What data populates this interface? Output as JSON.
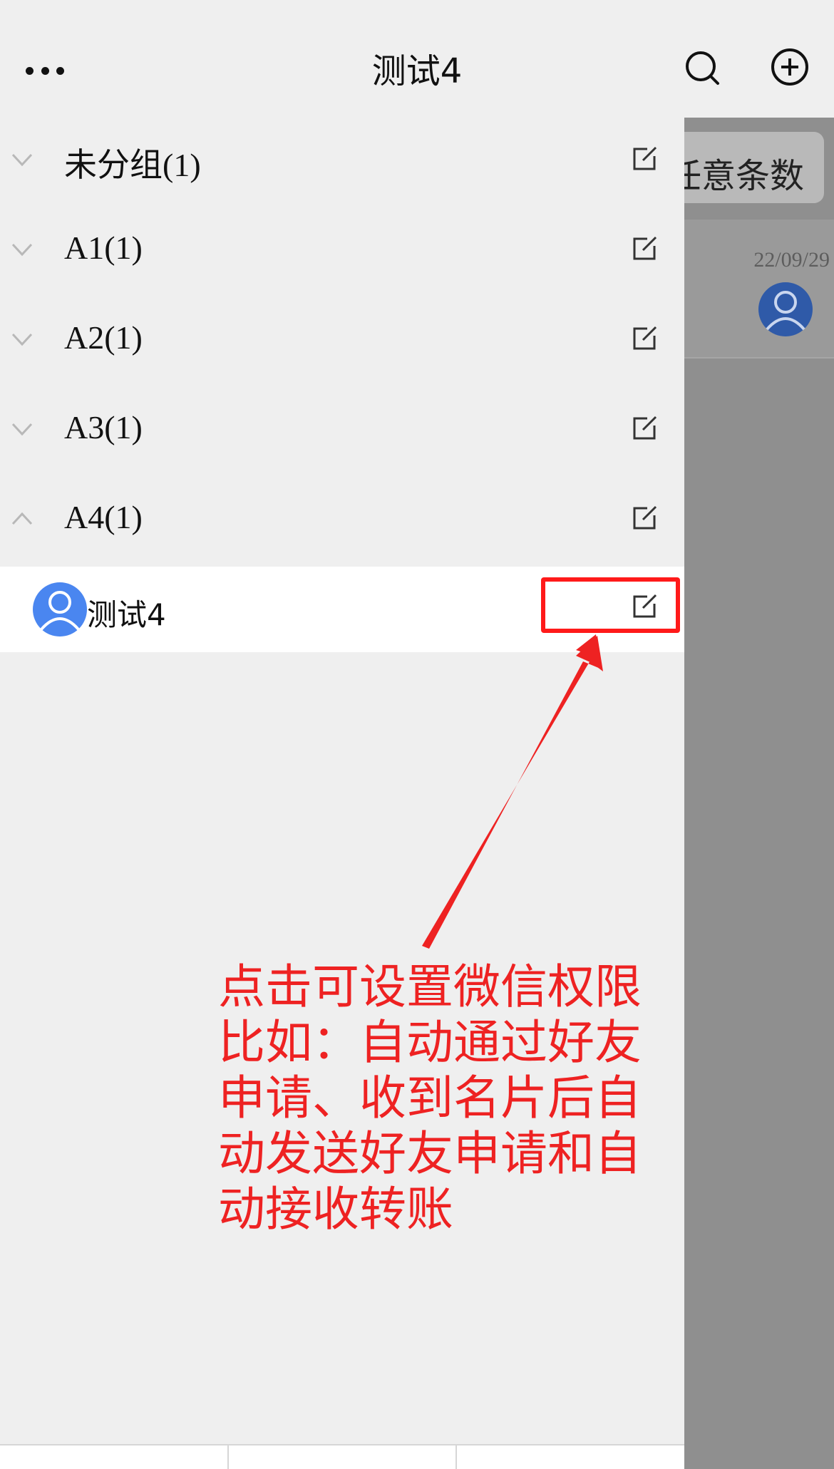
{
  "header": {
    "title": "测试4",
    "more_icon": "more-dots-icon",
    "search_icon": "search-icon",
    "add_icon": "add-circle-icon"
  },
  "background_page": {
    "chip_text": "任意条数",
    "date": "22/09/29"
  },
  "groups": [
    {
      "label": "未分组(1)",
      "expanded": false
    },
    {
      "label": "A1(1)",
      "expanded": false
    },
    {
      "label": "A2(1)",
      "expanded": false
    },
    {
      "label": "A3(1)",
      "expanded": false
    },
    {
      "label": "A4(1)",
      "expanded": true
    }
  ],
  "member": {
    "name": "测试4"
  },
  "annotation": {
    "lines": [
      "点击可设置微信权限",
      "比如：自动通过好友",
      "申请、收到名片后自",
      "动发送好友申请和自",
      "动接收转账"
    ],
    "color": "#ee2222"
  },
  "colors": {
    "avatar": "#4a86f0",
    "overlay": "#8f8f8f",
    "highlight": "#ff1a1a"
  }
}
